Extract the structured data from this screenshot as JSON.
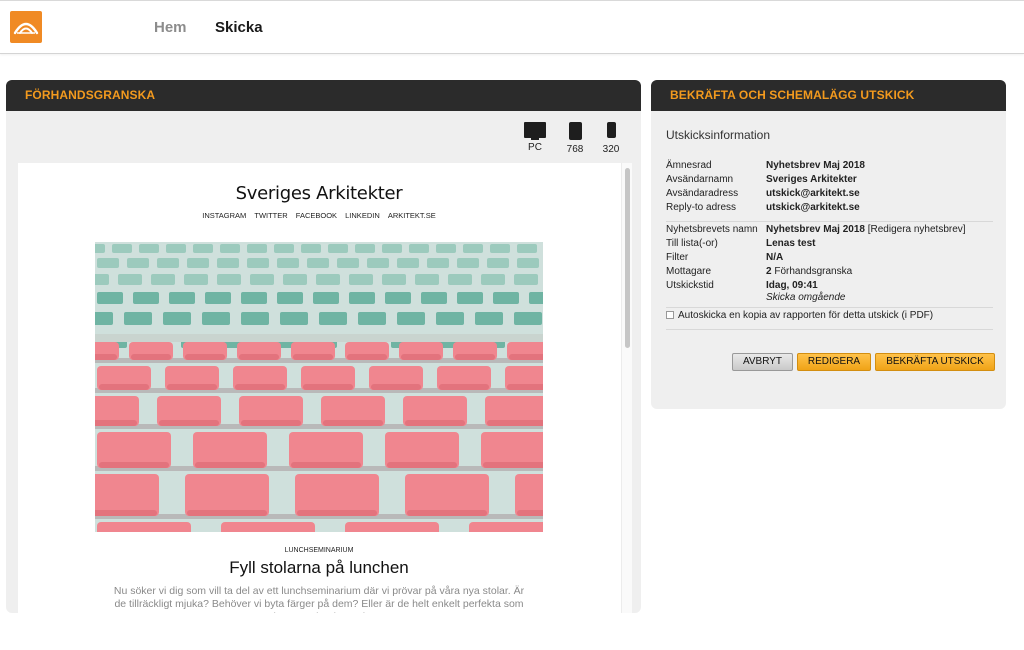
{
  "nav": {
    "items": [
      "Hem",
      "Skicka"
    ],
    "active": "Skicka"
  },
  "colors": {
    "accent": "#f08a24",
    "header_bg": "#2b2b2b",
    "header_text": "#f39a1e",
    "button_primary": "#f5ad25"
  },
  "preview_panel": {
    "title": "FÖRHANDSGRANSKA",
    "devices": [
      {
        "label": "PC",
        "icon": "monitor-icon"
      },
      {
        "label": "768",
        "icon": "tablet-icon"
      },
      {
        "label": "320",
        "icon": "phone-icon"
      }
    ],
    "newsletter": {
      "title": "Sveriges Arkitekter",
      "links": [
        "INSTAGRAM",
        "TWITTER",
        "FACEBOOK",
        "LINKEDIN",
        "ARKITEKT.SE"
      ],
      "kicker": "LUNCHSEMINARIUM",
      "headline": "Fyll stolarna på lunchen",
      "body": "Nu söker vi dig som vill ta del av ett lunchseminarium där vi prövar på våra nya stolar. Är de tillräckligt mjuka? Behöver vi byta färger på dem? Eller är de helt enkelt perfekta som de är? Delta du med!"
    }
  },
  "confirm_panel": {
    "title": "BEKRÄFTA OCH SCHEMALÄGG UTSKICK",
    "section_title": "Utskicksinformation",
    "info_group1": [
      {
        "key": "Ämnesrad",
        "value": "Nyhetsbrev Maj 2018"
      },
      {
        "key": "Avsändarnamn",
        "value": "Sveriges Arkitekter"
      },
      {
        "key": "Avsändaradress",
        "value": "utskick@arkitekt.se"
      },
      {
        "key": "Reply-to adress",
        "value": "utskick@arkitekt.se"
      }
    ],
    "info_group2": {
      "newsletter_name_key": "Nyhetsbrevets namn",
      "newsletter_name_value": "Nyhetsbrev Maj 2018",
      "edit_link": "[Redigera nyhetsbrev]",
      "list_key": "Till lista(-or)",
      "list_value": "Lenas test",
      "filter_key": "Filter",
      "filter_value": "N/A",
      "recipients_key": "Mottagare",
      "recipients_count": "2",
      "recipients_label": "Förhandsgranska",
      "send_time_key": "Utskickstid",
      "send_time_value": "Idag, 09:41",
      "send_time_sub": "Skicka omgående"
    },
    "auto_send_label": "Autoskicka en kopia av rapporten för detta utskick (i PDF)",
    "buttons": {
      "cancel": "AVBRYT",
      "edit": "REDIGERA",
      "confirm": "BEKRÄFTA UTSKICK"
    }
  }
}
